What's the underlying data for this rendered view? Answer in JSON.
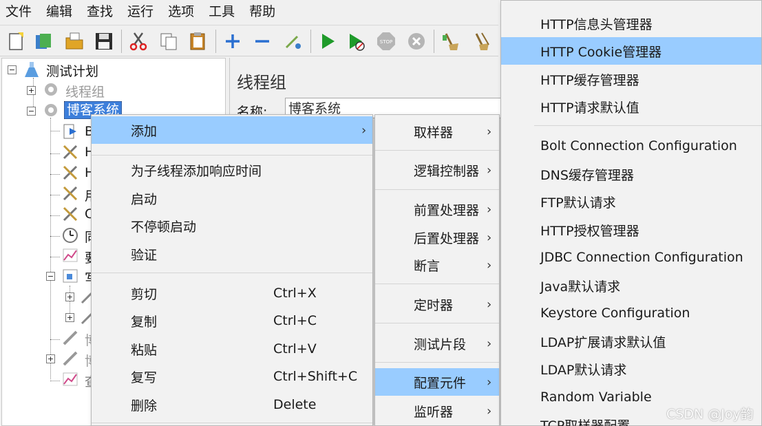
{
  "menubar": {
    "items": [
      "文件",
      "编辑",
      "查找",
      "运行",
      "选项",
      "工具",
      "帮助"
    ]
  },
  "toolbar": {
    "icons": [
      "new-icon",
      "templates-icon",
      "open-icon",
      "save-icon",
      "cut-icon",
      "copy-icon",
      "paste-icon",
      "expand-icon",
      "collapse-icon",
      "toggle-icon",
      "start-icon",
      "start-no-pause-icon",
      "stop-icon",
      "shutdown-icon",
      "clear-icon",
      "clear-all-icon"
    ]
  },
  "tree": {
    "root": "测试计划",
    "thread_group": "线程组",
    "selected": "博客系统",
    "child_initials": [
      "B",
      "H",
      "H",
      "用",
      "C",
      "同",
      "要",
      "写",
      "博",
      "博",
      "查"
    ]
  },
  "content": {
    "title": "线程组",
    "name_label": "名称:",
    "name_value": "博客系统"
  },
  "context_menu": {
    "items": [
      {
        "label": "添加",
        "arrow": "›"
      },
      {
        "label": "为子线程添加响应时间"
      },
      {
        "label": "启动"
      },
      {
        "label": "不停顿启动"
      },
      {
        "label": "验证"
      },
      {
        "label": "剪切",
        "shortcut": "Ctrl+X"
      },
      {
        "label": "复制",
        "shortcut": "Ctrl+C"
      },
      {
        "label": "粘贴",
        "shortcut": "Ctrl+V"
      },
      {
        "label": "复写",
        "shortcut": "Ctrl+Shift+C"
      },
      {
        "label": "删除",
        "shortcut": "Delete"
      }
    ]
  },
  "add_submenu": {
    "items": [
      "取样器",
      "逻辑控制器",
      "前置处理器",
      "后置处理器",
      "断言",
      "定时器",
      "测试片段",
      "配置元件",
      "监听器"
    ],
    "arrow": "›"
  },
  "config_submenu": {
    "items": [
      "HTTP信息头管理器",
      "HTTP Cookie管理器",
      "HTTP缓存管理器",
      "HTTP请求默认值",
      "Bolt Connection Configuration",
      "DNS缓存管理器",
      "FTP默认请求",
      "HTTP授权管理器",
      "JDBC Connection Configuration",
      "Java默认请求",
      "Keystore Configuration",
      "LDAP扩展请求默认值",
      "LDAP默认请求",
      "Random Variable",
      "TCP取样器配置"
    ]
  },
  "watermark": "CSDN @Joy韵",
  "colors": {
    "highlight": "#99ccff",
    "selected_tree": "#3d7fdb",
    "menu_bg": "#f2f2f2"
  }
}
